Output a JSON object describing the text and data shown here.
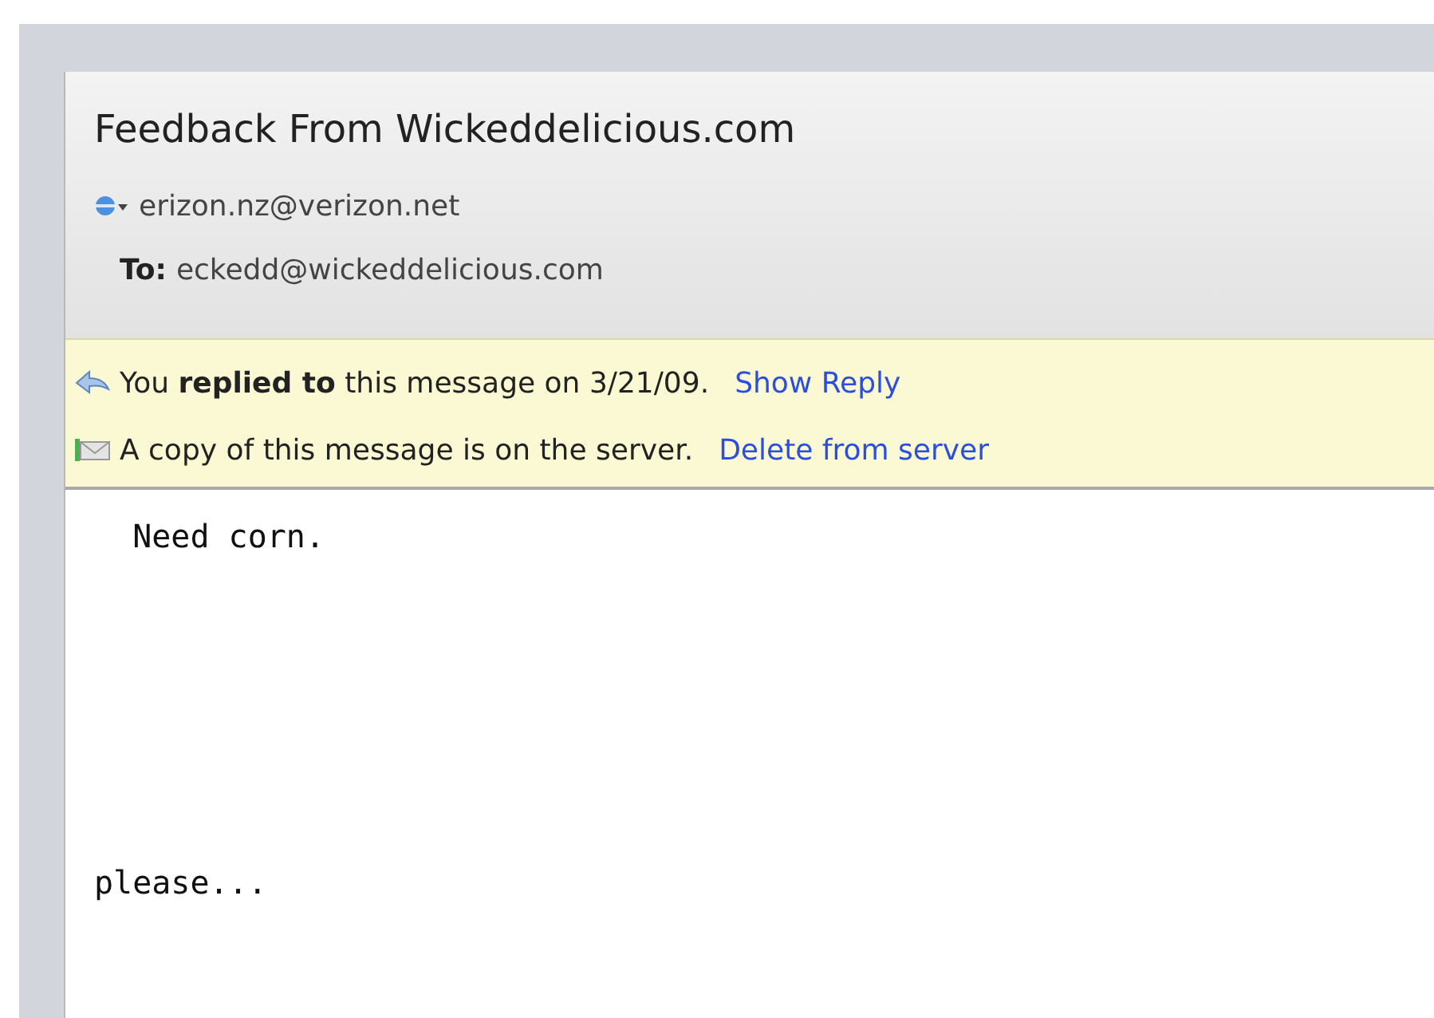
{
  "message": {
    "subject": "Feedback From Wickeddelicious.com",
    "from": "erizon.nz@verizon.net",
    "to_label": "To:",
    "to": "eckedd@wickeddelicious.com"
  },
  "notices": [
    {
      "kind": "replied",
      "text": "You **replied to** this message on 3/21/09.",
      "link": "Show Reply"
    },
    {
      "kind": "server",
      "text": "A copy of this message is on the server.",
      "link": "Delete from server"
    }
  ],
  "body": "  Need corn.\n\n\n\n\n\n\nplease..."
}
